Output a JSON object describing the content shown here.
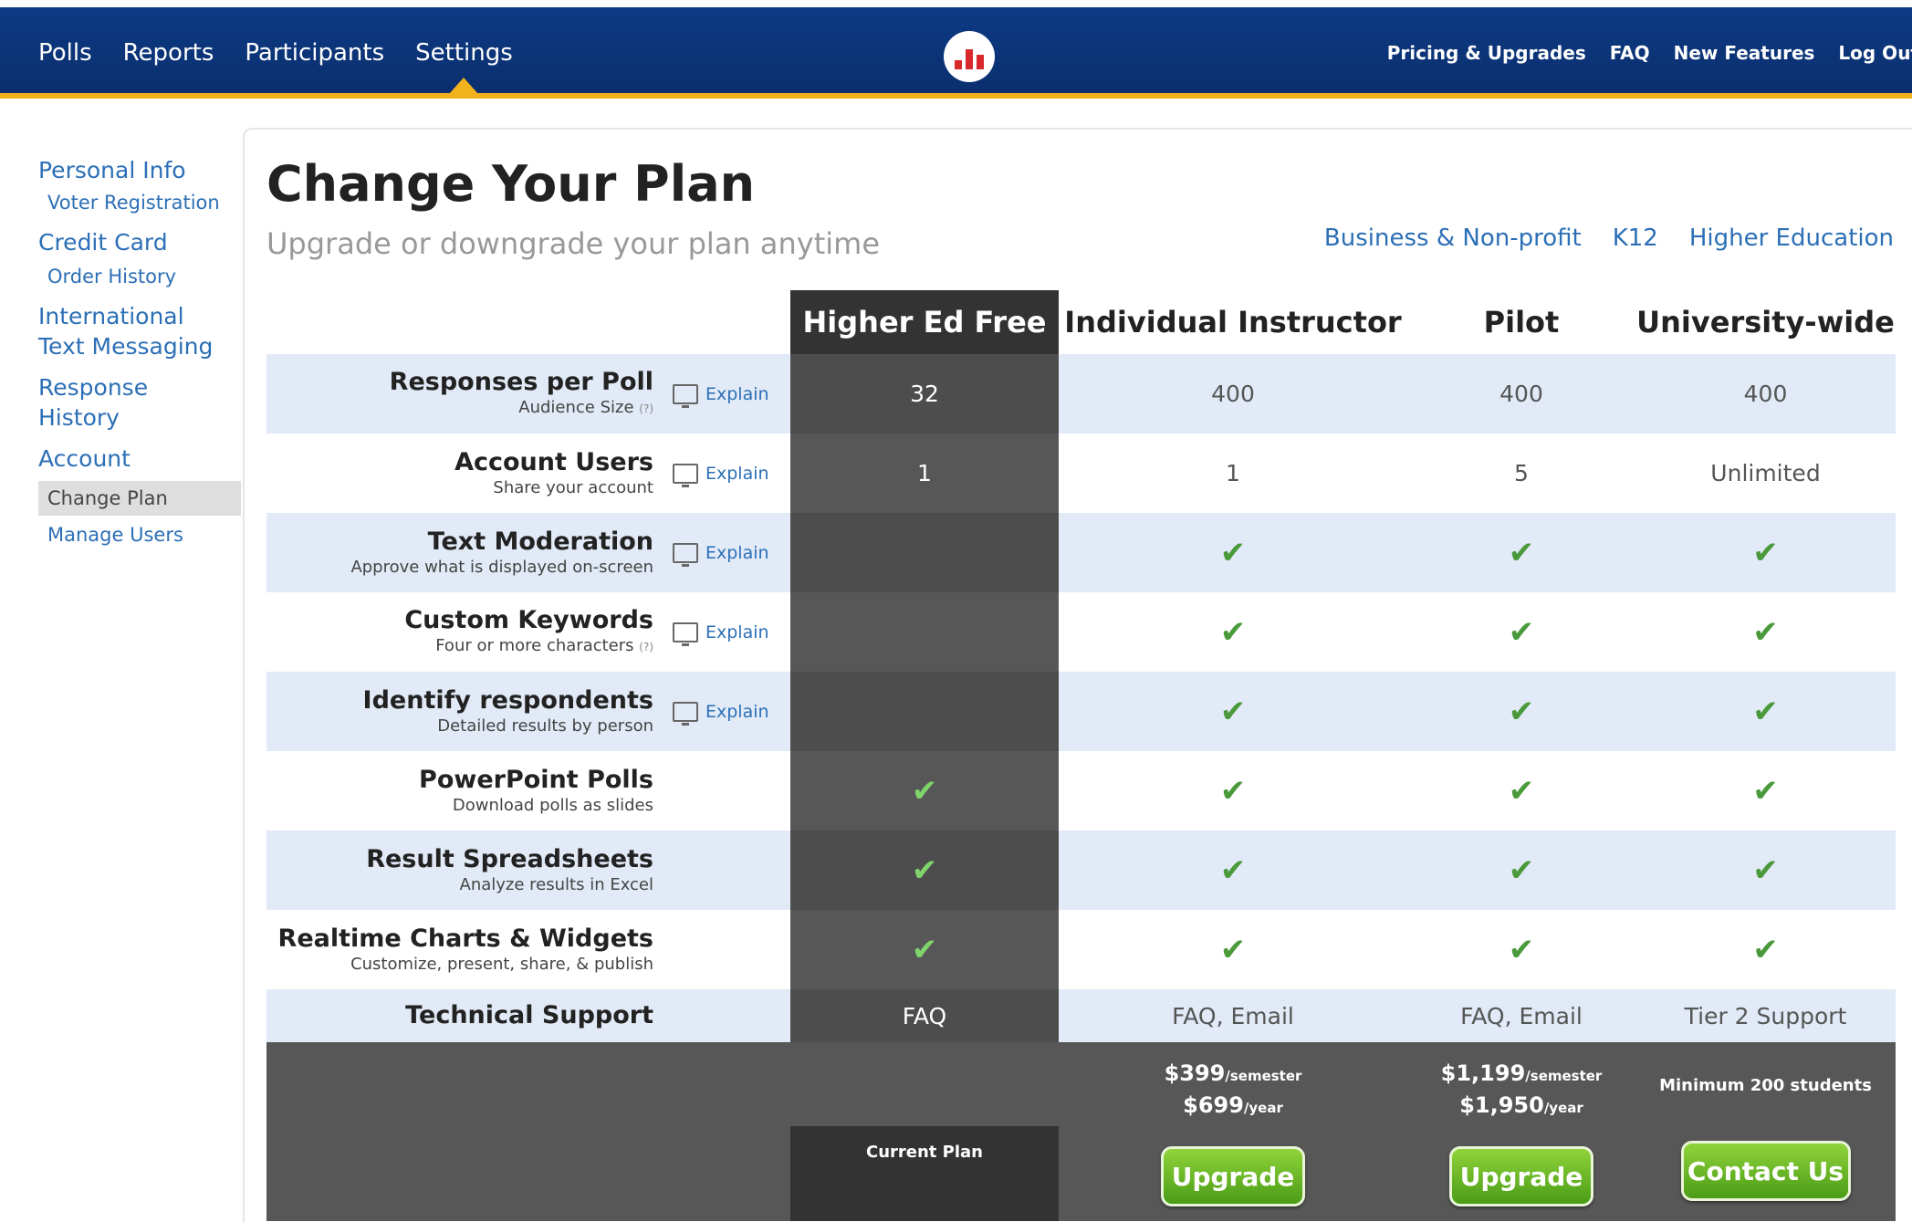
{
  "nav": {
    "left": [
      "Polls",
      "Reports",
      "Participants",
      "Settings"
    ],
    "right": [
      "Pricing & Upgrades",
      "FAQ",
      "New Features",
      "Log Out"
    ]
  },
  "sidebar": {
    "personal_info": "Personal Info",
    "voter_registration": "Voter Registration",
    "credit_card": "Credit Card",
    "order_history": "Order History",
    "intl_messaging_1": "International",
    "intl_messaging_2": "Text Messaging",
    "response_history_1": "Response",
    "response_history_2": "History",
    "account": "Account",
    "change_plan": "Change Plan",
    "manage_users": "Manage Users"
  },
  "page": {
    "title": "Change Your Plan",
    "subtitle": "Upgrade or downgrade your plan anytime",
    "segments": [
      "Business & Non-profit",
      "K12",
      "Higher Education"
    ]
  },
  "plans": {
    "names": [
      "Higher Ed Free",
      "Individual Instructor",
      "Pilot",
      "University-wide"
    ],
    "explain_label": "Explain",
    "check": "✔",
    "help_mark": "(?)",
    "features": [
      {
        "name": "Responses per Poll",
        "desc": "Audience Size",
        "values": [
          "32",
          "400",
          "400",
          "400"
        ]
      },
      {
        "name": "Account Users",
        "desc": "Share your account",
        "values": [
          "1",
          "1",
          "5",
          "Unlimited"
        ]
      },
      {
        "name": "Text Moderation",
        "desc": "Approve what is displayed on-screen",
        "values": [
          "",
          "✔",
          "✔",
          "✔"
        ]
      },
      {
        "name": "Custom Keywords",
        "desc": "Four or more characters",
        "values": [
          "",
          "✔",
          "✔",
          "✔"
        ]
      },
      {
        "name": "Identify respondents",
        "desc": "Detailed results by person",
        "values": [
          "",
          "✔",
          "✔",
          "✔"
        ]
      },
      {
        "name": "PowerPoint Polls",
        "desc": "Download polls as slides",
        "values": [
          "✔",
          "✔",
          "✔",
          "✔"
        ]
      },
      {
        "name": "Result Spreadsheets",
        "desc": "Analyze results in Excel",
        "values": [
          "✔",
          "✔",
          "✔",
          "✔"
        ]
      },
      {
        "name": "Realtime Charts & Widgets",
        "desc": "Customize, present, share, & publish",
        "values": [
          "✔",
          "✔",
          "✔",
          "✔"
        ]
      }
    ],
    "support": {
      "name": "Technical Support",
      "values": [
        "FAQ",
        "FAQ, Email",
        "FAQ, Email",
        "Tier 2 Support"
      ]
    },
    "pricing": {
      "current_plan": "Current Plan",
      "instructor": {
        "semester_price": "$399",
        "year_price": "$699",
        "button": "Upgrade"
      },
      "pilot": {
        "semester_price": "$1,199",
        "year_price": "$1,950",
        "button": "Upgrade"
      },
      "university": {
        "note": "Minimum 200 students",
        "button": "Contact Us"
      },
      "per_semester": "/semester",
      "per_year": "/year"
    }
  },
  "colors": {
    "nav_bg": "#0d3a84",
    "nav_accent": "#f2b21c",
    "link": "#2c6fb6",
    "row_alt": "#e1eaf6",
    "dark_column": "#575757",
    "check": "#4a9a3b",
    "button": "#5aa820"
  }
}
